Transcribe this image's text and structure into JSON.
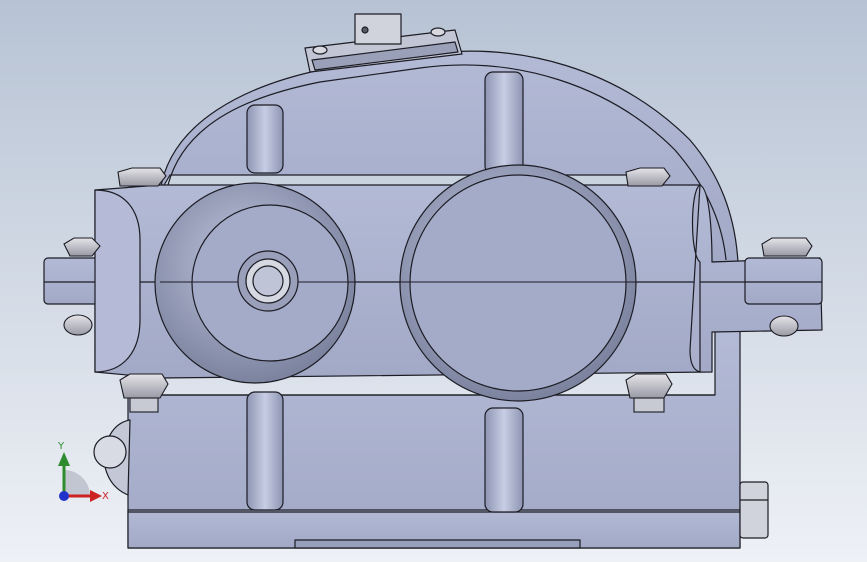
{
  "viewport": {
    "background_top": "#b9c5d6",
    "background_bottom": "#eef1f6",
    "body_color": "#a9b1cf",
    "edge_color": "#1c1c24"
  },
  "triad": {
    "x_label": "X",
    "y_label": "Y",
    "x_color": "#cc2222",
    "y_color": "#2e8b2e",
    "z_color": "#2233cc",
    "icons": [
      "x-axis-arrow-icon",
      "y-axis-arrow-icon",
      "z-axis-point-icon"
    ]
  }
}
